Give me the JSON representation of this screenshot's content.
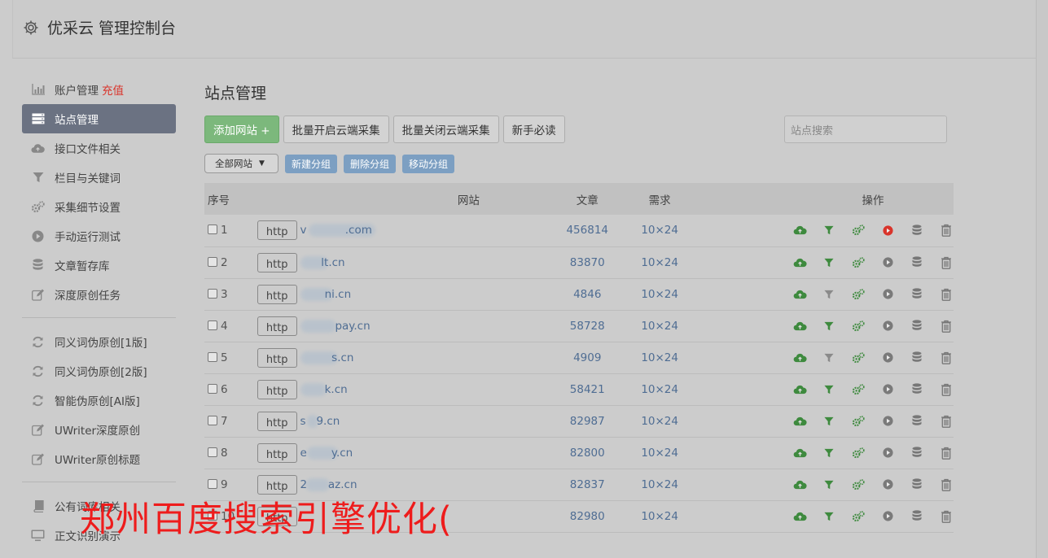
{
  "header": {
    "title": "优采云 管理控制台"
  },
  "sidebar": {
    "items": [
      {
        "label": "账户管理",
        "extra": "充值",
        "icon": "bar-chart-icon"
      },
      {
        "label": "站点管理",
        "icon": "server-icon",
        "active": true
      },
      {
        "label": "接口文件相关",
        "icon": "cloud-upload-icon"
      },
      {
        "label": "栏目与关键词",
        "icon": "filter-icon"
      },
      {
        "label": "采集细节设置",
        "icon": "cogs-icon"
      },
      {
        "label": "手动运行测试",
        "icon": "play-icon"
      },
      {
        "label": "文章暂存库",
        "icon": "database-icon"
      },
      {
        "label": "深度原创任务",
        "icon": "edit-icon"
      },
      {
        "label": "同义词伪原创[1版]",
        "icon": "refresh-icon"
      },
      {
        "label": "同义词伪原创[2版]",
        "icon": "refresh-icon"
      },
      {
        "label": "智能伪原创[AI版]",
        "icon": "refresh-icon"
      },
      {
        "label": "UWriter深度原创",
        "icon": "edit-icon"
      },
      {
        "label": "UWriter原创标题",
        "icon": "edit-icon"
      },
      {
        "label": "公有词库相关",
        "icon": "book-icon"
      },
      {
        "label": "正文识别演示",
        "icon": "monitor-icon"
      }
    ]
  },
  "main": {
    "title": "站点管理",
    "toolbar": {
      "add_site": "添加网站 +",
      "batch_open": "批量开启云端采集",
      "batch_close": "批量关闭云端采集",
      "newbie": "新手必读",
      "search_placeholder": "站点搜索"
    },
    "group": {
      "select_value": "全部网站",
      "new_group": "新建分组",
      "delete_group": "删除分组",
      "move_group": "移动分组"
    },
    "table": {
      "headers": [
        "序号",
        "网站",
        "文章",
        "需求",
        "操作"
      ],
      "rows": [
        {
          "no": "1",
          "scheme": "http",
          "domain": "v           .com",
          "articles": "456814",
          "demand": "10×24",
          "filter_active": true,
          "play_active": true
        },
        {
          "no": "2",
          "scheme": "http",
          "domain": "      lt.cn",
          "articles": "83870",
          "demand": "10×24",
          "filter_active": true,
          "play_active": false
        },
        {
          "no": "3",
          "scheme": "http",
          "domain": "       ni.cn",
          "articles": "4846",
          "demand": "10×24",
          "filter_active": false,
          "play_active": false
        },
        {
          "no": "4",
          "scheme": "http",
          "domain": "          pay.cn",
          "articles": "58728",
          "demand": "10×24",
          "filter_active": true,
          "play_active": false
        },
        {
          "no": "5",
          "scheme": "http",
          "domain": "         s.cn",
          "articles": "4909",
          "demand": "10×24",
          "filter_active": false,
          "play_active": false
        },
        {
          "no": "6",
          "scheme": "http",
          "domain": "       k.cn",
          "articles": "58421",
          "demand": "10×24",
          "filter_active": true,
          "play_active": false
        },
        {
          "no": "7",
          "scheme": "http",
          "domain": "s   9.cn",
          "articles": "82987",
          "demand": "10×24",
          "filter_active": true,
          "play_active": false
        },
        {
          "no": "8",
          "scheme": "http",
          "domain": "e       y.cn",
          "articles": "82800",
          "demand": "10×24",
          "filter_active": true,
          "play_active": false
        },
        {
          "no": "9",
          "scheme": "http",
          "domain": "2      az.cn",
          "articles": "82837",
          "demand": "10×24",
          "filter_active": true,
          "play_active": false
        },
        {
          "no": "10",
          "scheme": "http",
          "domain": "",
          "articles": "82980",
          "demand": "10×24",
          "filter_active": true,
          "play_active": false
        }
      ]
    }
  },
  "overlay": {
    "watermark": "郑州百度搜索引擎优化("
  },
  "colors": {
    "active_sidebar": "#6b7282",
    "green_button": "#7cb87c",
    "blue_button": "#7c9fc2",
    "link": "#4f6d93",
    "red": "#d9342b",
    "watermark": "#ee1c1c"
  }
}
